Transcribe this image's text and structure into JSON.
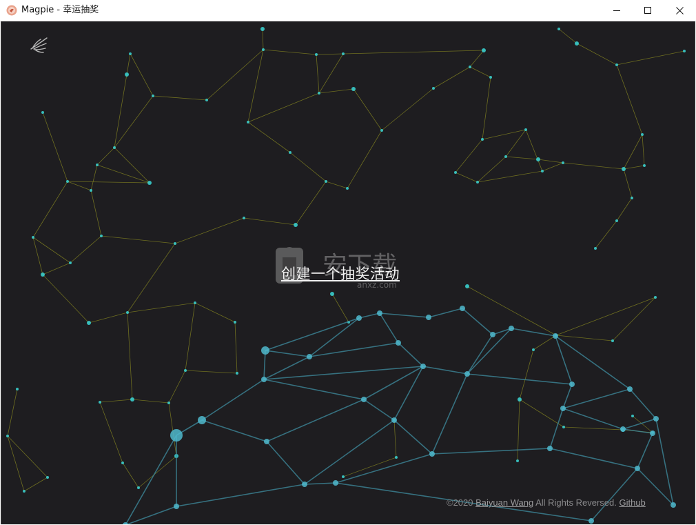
{
  "window": {
    "title": "Magpie - 幸运抽奖",
    "app_icon": "magpie-app-icon",
    "controls": [
      "minimize-icon",
      "maximize-icon",
      "close-icon"
    ]
  },
  "main": {
    "logo_icon": "magpie-feather-logo-icon",
    "create_link_label": "创建一个抽奖活动",
    "watermark_icon": "anxz-watermark-icon"
  },
  "footer": {
    "copyright_prefix": "©2020 ",
    "author": "Baiyuan Wang",
    "rights": " All Rights Reversed. ",
    "github_label": "Github"
  },
  "colors": {
    "background": "#1e1d20",
    "yellow_lines": "#8a8a20",
    "cyan_nodes": "#3ad6d6",
    "globe_lines": "#3f8ea0",
    "globe_nodes": "#4fb8cc"
  }
}
